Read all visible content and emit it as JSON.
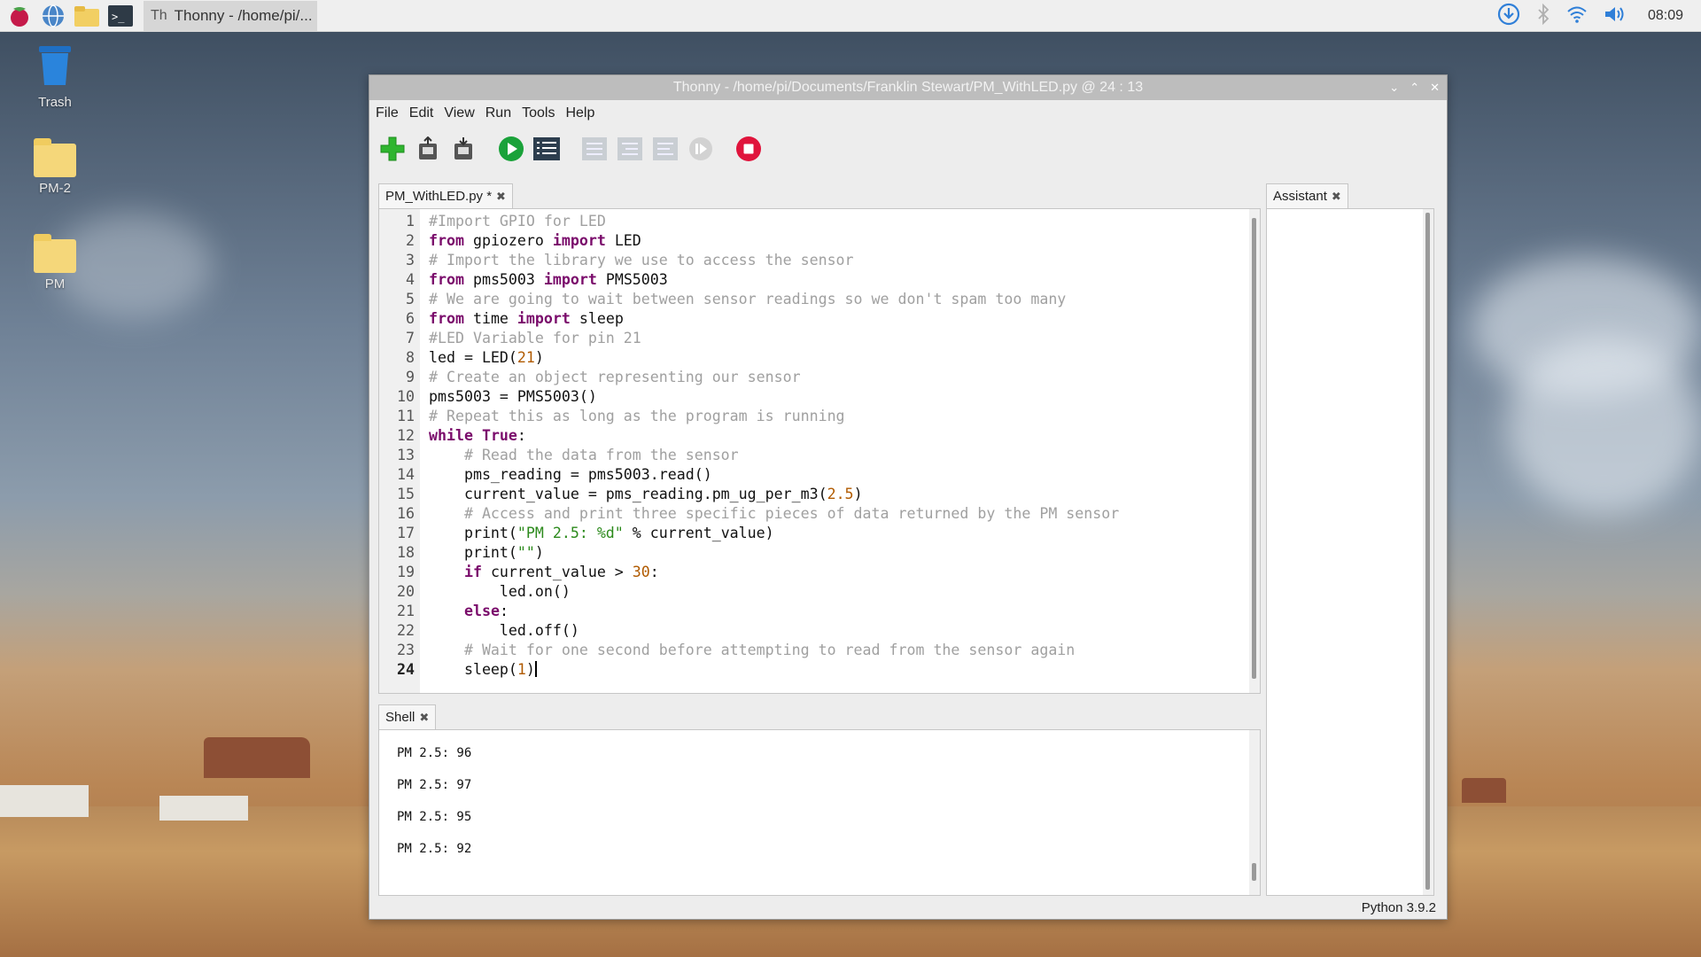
{
  "taskbar": {
    "task_title": "Thonny  -  /home/pi/...",
    "clock": "08:09"
  },
  "desktop": {
    "icons": [
      {
        "label": "Trash"
      },
      {
        "label": "PM-2"
      },
      {
        "label": "PM"
      }
    ]
  },
  "window": {
    "title": "Thonny  -  /home/pi/Documents/Franklin Stewart/PM_WithLED.py  @  24 : 13",
    "menu": [
      "File",
      "Edit",
      "View",
      "Run",
      "Tools",
      "Help"
    ],
    "editor_tab": "PM_WithLED.py *",
    "shell_tab": "Shell",
    "assistant_tab": "Assistant",
    "status": "Python 3.9.2"
  },
  "code_lines": [
    {
      "n": "1",
      "t": "#Import GPIO for LED"
    },
    {
      "n": "2",
      "t": "from gpiozero import LED"
    },
    {
      "n": "3",
      "t": "# Import the library we use to access the sensor"
    },
    {
      "n": "4",
      "t": "from pms5003 import PMS5003"
    },
    {
      "n": "5",
      "t": "# We are going to wait between sensor readings so we don't spam too many"
    },
    {
      "n": "6",
      "t": "from time import sleep"
    },
    {
      "n": "7",
      "t": "#LED Variable for pin 21"
    },
    {
      "n": "8",
      "t": "led = LED(21)"
    },
    {
      "n": "9",
      "t": "# Create an object representing our sensor"
    },
    {
      "n": "10",
      "t": "pms5003 = PMS5003()"
    },
    {
      "n": "11",
      "t": "# Repeat this as long as the program is running"
    },
    {
      "n": "12",
      "t": "while True:"
    },
    {
      "n": "13",
      "t": "    # Read the data from the sensor"
    },
    {
      "n": "14",
      "t": "    pms_reading = pms5003.read()"
    },
    {
      "n": "15",
      "t": "    current_value = pms_reading.pm_ug_per_m3(2.5)"
    },
    {
      "n": "16",
      "t": "    # Access and print three specific pieces of data returned by the PM sensor"
    },
    {
      "n": "17",
      "t": "    print(\"PM 2.5: %d\" % current_value)"
    },
    {
      "n": "18",
      "t": "    print(\"\")"
    },
    {
      "n": "19",
      "t": "    if current_value > 30:"
    },
    {
      "n": "20",
      "t": "        led.on()"
    },
    {
      "n": "21",
      "t": "    else:"
    },
    {
      "n": "22",
      "t": "        led.off()"
    },
    {
      "n": "23",
      "t": "    # Wait for one second before attempting to read from the sensor again"
    },
    {
      "n": "24",
      "t": "    sleep(1)"
    }
  ],
  "shell_lines": [
    "PM 2.5: 96",
    "PM 2.5: 97",
    "PM 2.5: 95",
    "PM 2.5: 92"
  ],
  "colors": {
    "keyword": "#7a0b6b",
    "comment": "#a0a0a0",
    "string": "#2c8a1c",
    "number": "#b05a00",
    "run_button": "#1aa23a",
    "stop_button": "#e0143c",
    "new_button": "#2fb52f"
  }
}
